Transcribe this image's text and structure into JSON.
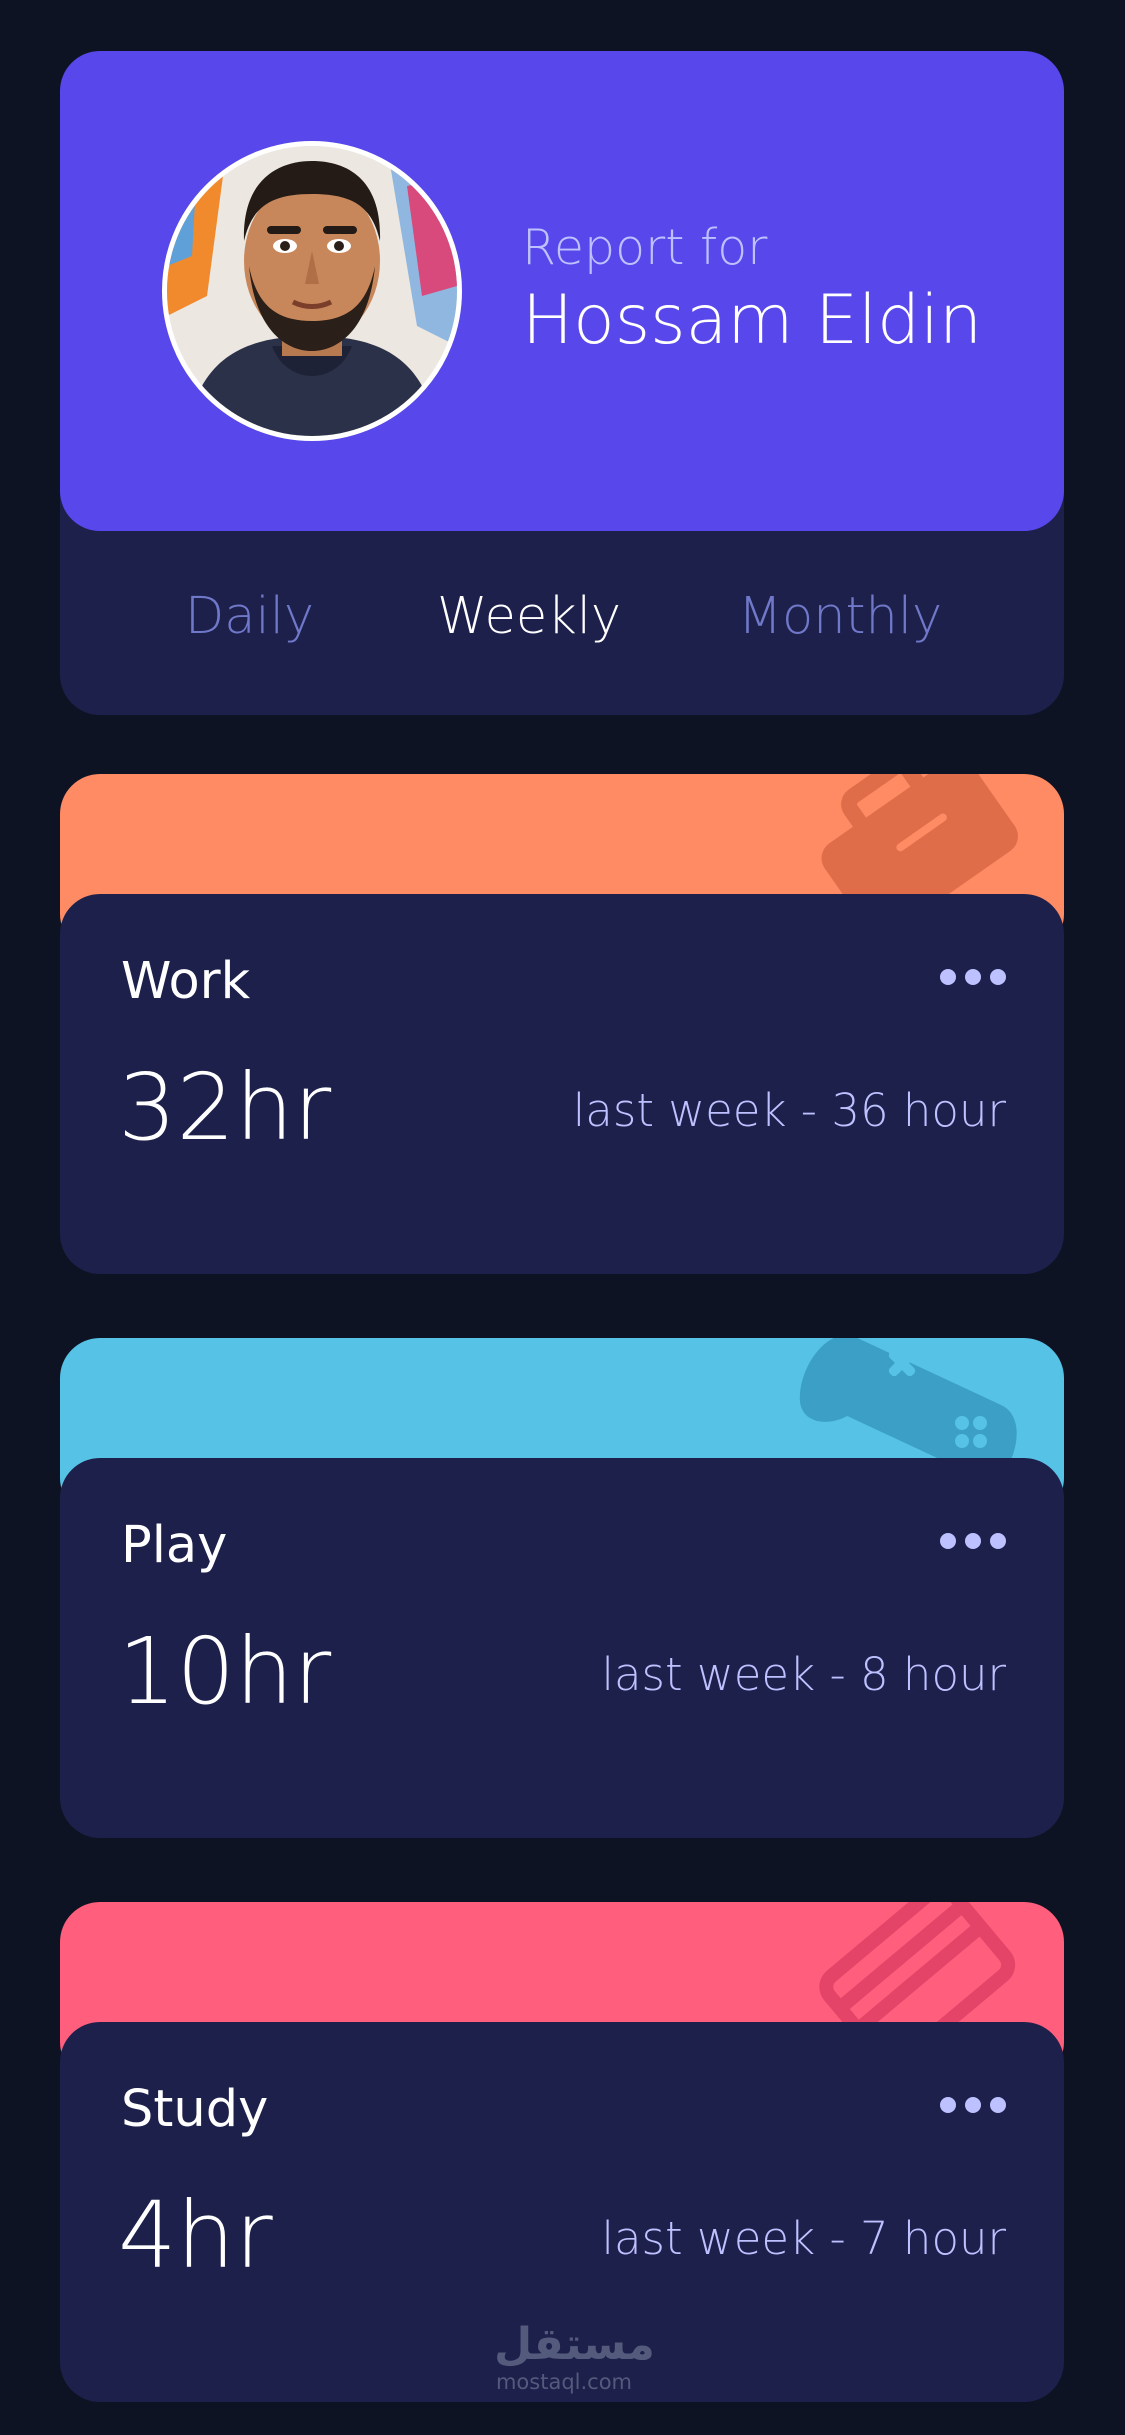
{
  "profile": {
    "report_label": "Report for",
    "user_name": "Hossam Eldin"
  },
  "tabs": [
    {
      "label": "Daily",
      "active": false
    },
    {
      "label": "Weekly",
      "active": true
    },
    {
      "label": "Monthly",
      "active": false
    }
  ],
  "activities": [
    {
      "title": "Work",
      "current": "32hr",
      "previous": "last week - 36 hour",
      "color": "#ff8b64",
      "icon": "briefcase-icon"
    },
    {
      "title": "Play",
      "current": "10hr",
      "previous": "last week - 8 hour",
      "color": "#56c2e6",
      "icon": "gamepad-icon"
    },
    {
      "title": "Study",
      "current": "4hr",
      "previous": "last week - 7 hour",
      "color": "#ff5e7d",
      "icon": "book-icon"
    }
  ],
  "watermark": {
    "brand": "مستقل",
    "url": "mostaql.com"
  },
  "colors": {
    "background": "#0e1323",
    "card": "#1d204b",
    "accent": "#5847eb",
    "muted": "#7078c9",
    "pale": "#bdc1ff"
  }
}
